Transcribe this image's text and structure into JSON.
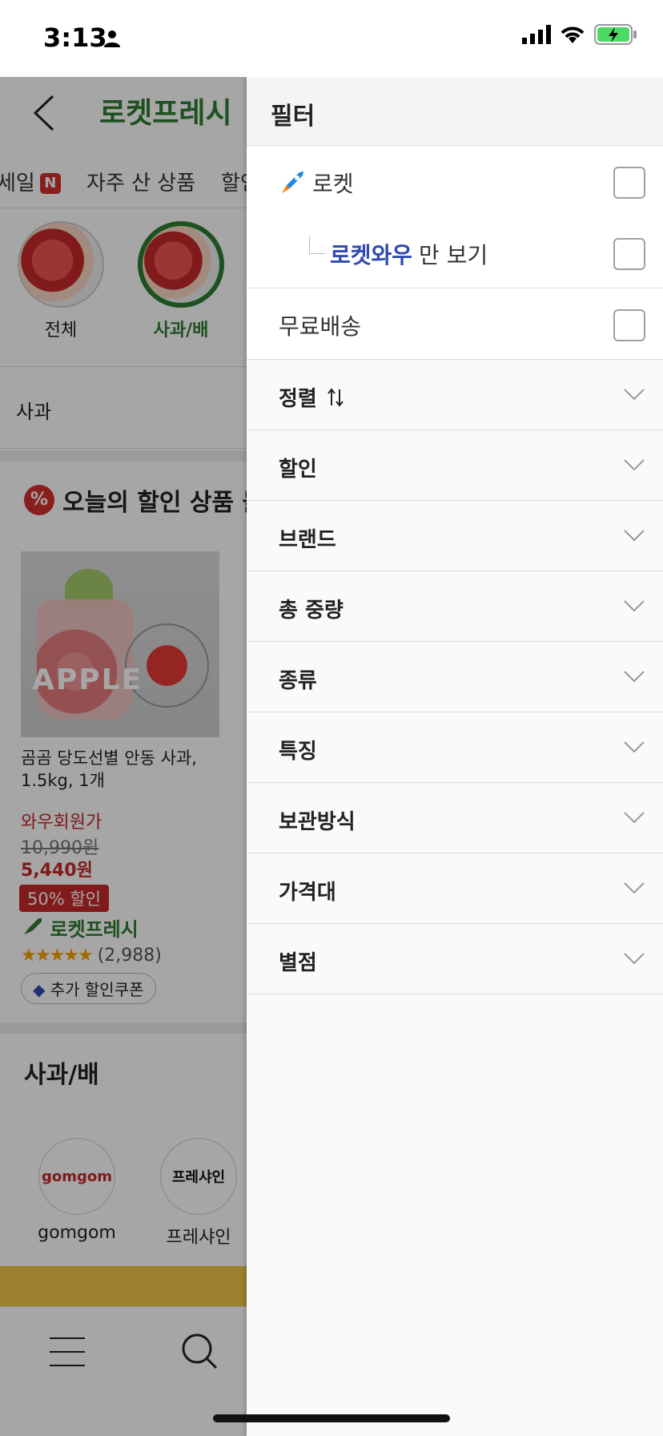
{
  "status": {
    "time": "3:13"
  },
  "background": {
    "title": "로켓프레시",
    "tabs": [
      "세일",
      "자주 산 상품",
      "할인"
    ],
    "tab_badge": "N",
    "categories": [
      {
        "label": "전체"
      },
      {
        "label": "사과/배"
      }
    ],
    "sub_category": "사과",
    "deal_title": "오늘의 할인 상품 몰",
    "deal_badge": "%",
    "product": {
      "image_text": "APPLE",
      "name": "곰곰 당도선별 안동 사과, 1.5kg, 1개",
      "member_label": "와우회원가",
      "original_price": "10,990원",
      "price": "5,440원",
      "discount": "50% 할인",
      "brand": "로켓프레시",
      "stars": "★★★★★",
      "reviews": "(2,988)",
      "coupon": "추가 할인쿠폰"
    },
    "section_title": "사과/배",
    "brands": [
      {
        "label": "gomgom",
        "logo_text": "gomgom"
      },
      {
        "label": "프레샤인",
        "logo_text": "프레샤인"
      }
    ]
  },
  "filter": {
    "title": "필터",
    "options": [
      {
        "label": "로켓",
        "icon": "rocket-icon",
        "checked": false
      },
      {
        "label_highlight": "로켓와우",
        "label_rest": "만 보기",
        "checked": false
      },
      {
        "label": "무료배송",
        "checked": false
      }
    ],
    "sections": [
      {
        "label": "정렬",
        "icon": "sort-arrows-icon"
      },
      {
        "label": "할인"
      },
      {
        "label": "브랜드"
      },
      {
        "label": "총 중량"
      },
      {
        "label": "종류"
      },
      {
        "label": "특징"
      },
      {
        "label": "보관방식"
      },
      {
        "label": "가격대"
      },
      {
        "label": "별점"
      }
    ]
  },
  "colors": {
    "accent_green": "#2e7d32",
    "wow_blue": "#2f4ab0",
    "sale_red": "#c62828"
  }
}
